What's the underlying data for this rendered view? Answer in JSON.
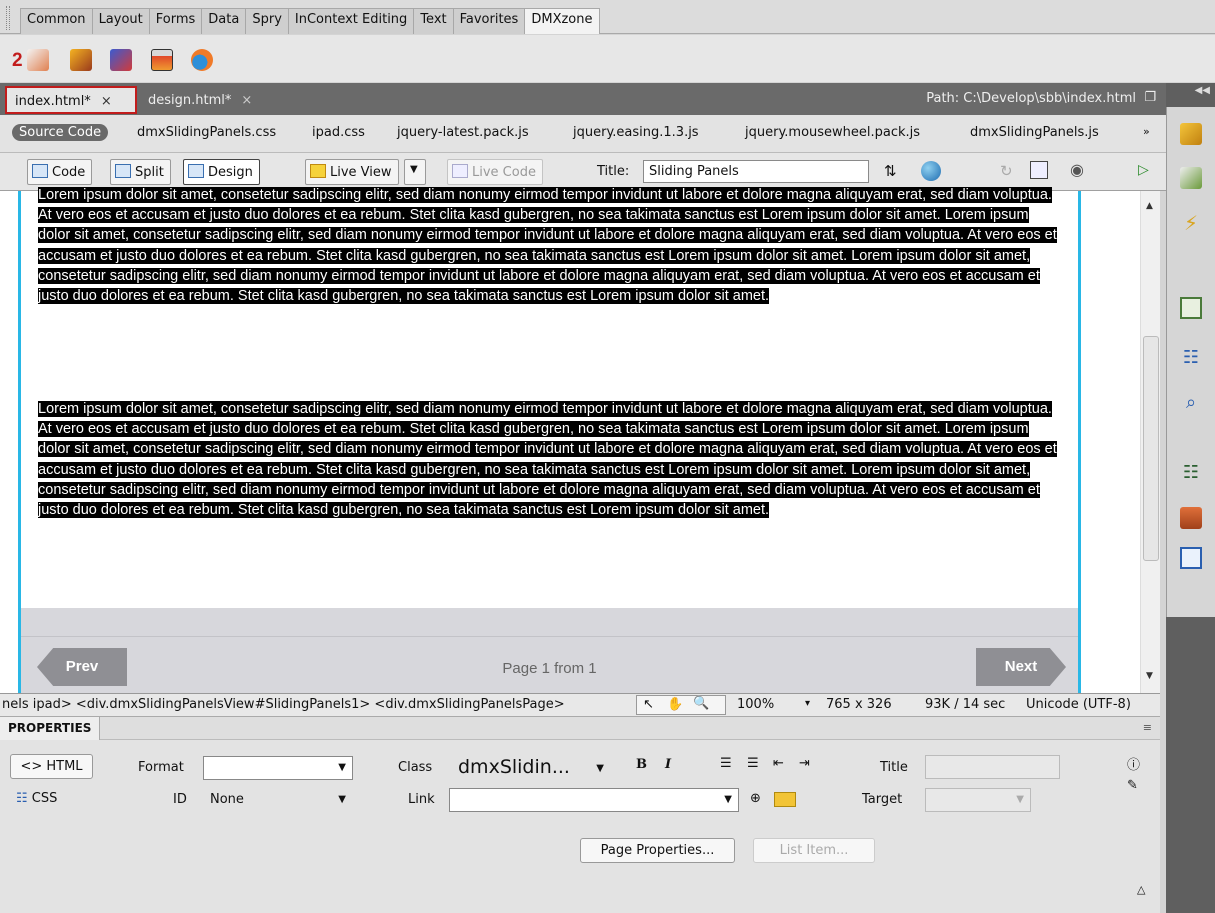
{
  "insert_tabs": [
    "Common",
    "Layout",
    "Forms",
    "Data",
    "Spry",
    "InContext Editing",
    "Text",
    "Favorites",
    "DMXzone"
  ],
  "insert_icon_bar": {
    "annotation": "2",
    "icons": [
      "dmx-icon-1",
      "dmx-icon-2",
      "dmx-icon-3",
      "dmx-icon-4",
      "dmx-icon-5"
    ]
  },
  "doc_tabs": [
    {
      "label": "index.html*",
      "close": "×"
    },
    {
      "label": "design.html*",
      "close": "×"
    }
  ],
  "path": "Path:  C:\\Develop\\sbb\\index.html",
  "related_files": [
    "Source Code",
    "dmxSlidingPanels.css",
    "ipad.css",
    "jquery-latest.pack.js",
    "jquery.easing.1.3.js",
    "jquery.mousewheel.pack.js",
    "dmxSlidingPanels.js"
  ],
  "toolbar": {
    "code": "Code",
    "split": "Split",
    "design": "Design",
    "live_view": "Live View",
    "live_code": "Live Code",
    "title_label": "Title:",
    "title_value": "Sliding Panels"
  },
  "content": {
    "paragraph_1": "Lorem ipsum dolor sit amet, consetetur sadipscing elitr, sed diam nonumy eirmod tempor invidunt ut labore et dolore magna aliquyam erat, sed diam voluptua. At vero eos et accusam et justo duo dolores et ea rebum. Stet clita kasd gubergren, no sea takimata sanctus est Lorem ipsum dolor sit amet. Lorem ipsum dolor sit amet, consetetur sadipscing elitr, sed diam nonumy eirmod tempor invidunt ut labore et dolore magna aliquyam erat, sed diam voluptua. At vero eos et accusam et justo duo dolores et ea rebum. Stet clita kasd gubergren, no sea takimata sanctus est Lorem ipsum dolor sit amet. Lorem ipsum dolor sit amet, consetetur sadipscing elitr, sed diam nonumy eirmod tempor invidunt ut labore et dolore magna aliquyam erat, sed diam voluptua. At vero eos et accusam et justo duo dolores et ea rebum. Stet clita kasd gubergren, no sea takimata sanctus est Lorem ipsum dolor sit amet.",
    "paragraph_2": "Lorem ipsum dolor sit amet, consetetur sadipscing elitr, sed diam nonumy eirmod tempor invidunt ut labore et dolore magna aliquyam erat, sed diam voluptua. At vero eos et accusam et justo duo dolores et ea rebum. Stet clita kasd gubergren, no sea takimata sanctus est Lorem ipsum dolor sit amet. Lorem ipsum dolor sit amet, consetetur sadipscing elitr, sed diam nonumy eirmod tempor invidunt ut labore et dolore magna aliquyam erat, sed diam voluptua. At vero eos et accusam et justo duo dolores et ea rebum. Stet clita kasd gubergren, no sea takimata sanctus est Lorem ipsum dolor sit amet. Lorem ipsum dolor sit amet, consetetur sadipscing elitr, sed diam nonumy eirmod tempor invidunt ut labore et dolore magna aliquyam erat, sed diam voluptua. At vero eos et accusam et justo duo dolores et ea rebum. Stet clita kasd gubergren, no sea takimata sanctus est Lorem ipsum dolor sit amet.",
    "prev": "Prev",
    "next": "Next",
    "page_indicator": "Page 1 from 1"
  },
  "status_bar": {
    "tag_selector": "nels ipad> <div.dmxSlidingPanelsView#SlidingPanels1> <div.dmxSlidingPanelsPage>",
    "zoom": "100%",
    "window_size": "765 x 326",
    "download": "93K / 14 sec",
    "encoding": "Unicode (UTF-8)"
  },
  "properties": {
    "header": "PROPERTIES",
    "html_button": "HTML",
    "css_button": "CSS",
    "format_label": "Format",
    "format_value": "",
    "id_label": "ID",
    "id_value": "None",
    "class_label": "Class",
    "class_value": "dmxSlidin...",
    "bold": "B",
    "italic": "I",
    "link_label": "Link",
    "link_value": "",
    "title_label": "Title",
    "title_value": "",
    "target_label": "Target",
    "target_value": "",
    "page_properties": "Page Properties...",
    "list_item": "List Item..."
  },
  "colors": {
    "accent_red": "#c21c1c",
    "panel_border": "#29b7e6"
  }
}
